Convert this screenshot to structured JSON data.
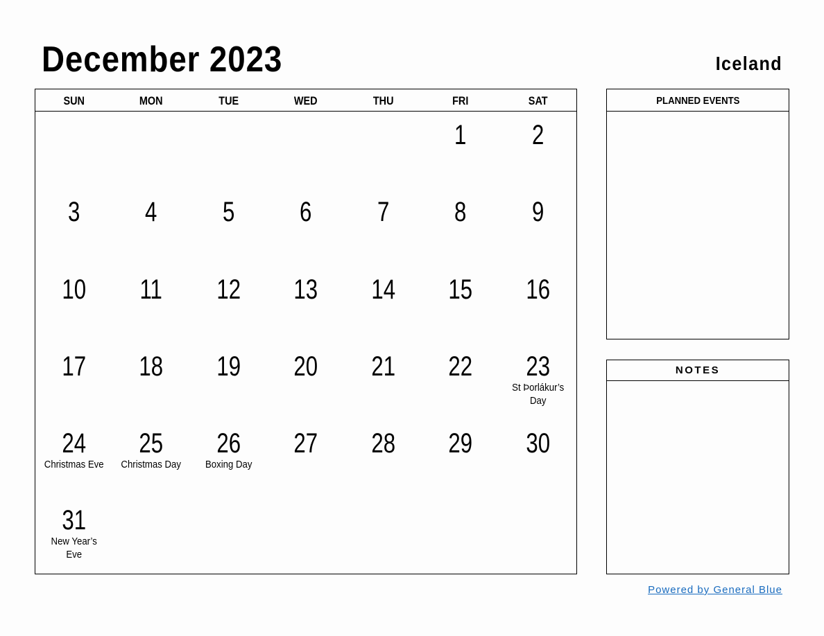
{
  "header": {
    "title": "December 2023",
    "country": "Iceland"
  },
  "calendar": {
    "weekdays": [
      "SUN",
      "MON",
      "TUE",
      "WED",
      "THU",
      "FRI",
      "SAT"
    ],
    "weeks": [
      [
        {
          "day": ""
        },
        {
          "day": ""
        },
        {
          "day": ""
        },
        {
          "day": ""
        },
        {
          "day": ""
        },
        {
          "day": "1"
        },
        {
          "day": "2"
        }
      ],
      [
        {
          "day": "3"
        },
        {
          "day": "4"
        },
        {
          "day": "5"
        },
        {
          "day": "6"
        },
        {
          "day": "7"
        },
        {
          "day": "8"
        },
        {
          "day": "9"
        }
      ],
      [
        {
          "day": "10"
        },
        {
          "day": "11"
        },
        {
          "day": "12"
        },
        {
          "day": "13"
        },
        {
          "day": "14"
        },
        {
          "day": "15"
        },
        {
          "day": "16"
        }
      ],
      [
        {
          "day": "17"
        },
        {
          "day": "18"
        },
        {
          "day": "19"
        },
        {
          "day": "20"
        },
        {
          "day": "21"
        },
        {
          "day": "22"
        },
        {
          "day": "23",
          "holiday": "St Þorlákur’s Day"
        }
      ],
      [
        {
          "day": "24",
          "holiday": "Christmas Eve"
        },
        {
          "day": "25",
          "holiday": "Christmas Day"
        },
        {
          "day": "26",
          "holiday": "Boxing Day"
        },
        {
          "day": "27"
        },
        {
          "day": "28"
        },
        {
          "day": "29"
        },
        {
          "day": "30"
        }
      ],
      [
        {
          "day": "31",
          "holiday": "New Year’s Eve"
        },
        {
          "day": ""
        },
        {
          "day": ""
        },
        {
          "day": ""
        },
        {
          "day": ""
        },
        {
          "day": ""
        },
        {
          "day": ""
        }
      ]
    ]
  },
  "panels": {
    "planned_events_label": "PLANNED EVENTS",
    "notes_label": "NOTES"
  },
  "footer": {
    "link_text": "Powered by General Blue",
    "link_color": "#1a6cbf"
  }
}
